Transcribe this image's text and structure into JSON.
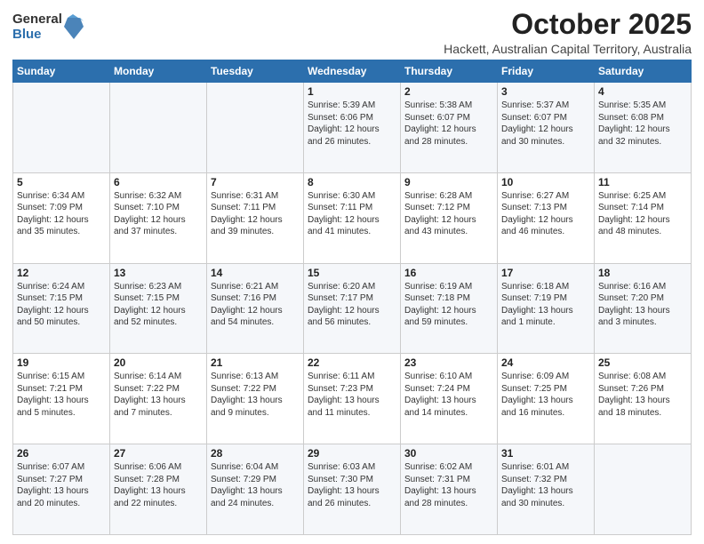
{
  "logo": {
    "general": "General",
    "blue": "Blue"
  },
  "header": {
    "month": "October 2025",
    "location": "Hackett, Australian Capital Territory, Australia"
  },
  "weekdays": [
    "Sunday",
    "Monday",
    "Tuesday",
    "Wednesday",
    "Thursday",
    "Friday",
    "Saturday"
  ],
  "weeks": [
    [
      {
        "day": "",
        "info": ""
      },
      {
        "day": "",
        "info": ""
      },
      {
        "day": "",
        "info": ""
      },
      {
        "day": "1",
        "info": "Sunrise: 5:39 AM\nSunset: 6:06 PM\nDaylight: 12 hours\nand 26 minutes."
      },
      {
        "day": "2",
        "info": "Sunrise: 5:38 AM\nSunset: 6:07 PM\nDaylight: 12 hours\nand 28 minutes."
      },
      {
        "day": "3",
        "info": "Sunrise: 5:37 AM\nSunset: 6:07 PM\nDaylight: 12 hours\nand 30 minutes."
      },
      {
        "day": "4",
        "info": "Sunrise: 5:35 AM\nSunset: 6:08 PM\nDaylight: 12 hours\nand 32 minutes."
      }
    ],
    [
      {
        "day": "5",
        "info": "Sunrise: 6:34 AM\nSunset: 7:09 PM\nDaylight: 12 hours\nand 35 minutes."
      },
      {
        "day": "6",
        "info": "Sunrise: 6:32 AM\nSunset: 7:10 PM\nDaylight: 12 hours\nand 37 minutes."
      },
      {
        "day": "7",
        "info": "Sunrise: 6:31 AM\nSunset: 7:11 PM\nDaylight: 12 hours\nand 39 minutes."
      },
      {
        "day": "8",
        "info": "Sunrise: 6:30 AM\nSunset: 7:11 PM\nDaylight: 12 hours\nand 41 minutes."
      },
      {
        "day": "9",
        "info": "Sunrise: 6:28 AM\nSunset: 7:12 PM\nDaylight: 12 hours\nand 43 minutes."
      },
      {
        "day": "10",
        "info": "Sunrise: 6:27 AM\nSunset: 7:13 PM\nDaylight: 12 hours\nand 46 minutes."
      },
      {
        "day": "11",
        "info": "Sunrise: 6:25 AM\nSunset: 7:14 PM\nDaylight: 12 hours\nand 48 minutes."
      }
    ],
    [
      {
        "day": "12",
        "info": "Sunrise: 6:24 AM\nSunset: 7:15 PM\nDaylight: 12 hours\nand 50 minutes."
      },
      {
        "day": "13",
        "info": "Sunrise: 6:23 AM\nSunset: 7:15 PM\nDaylight: 12 hours\nand 52 minutes."
      },
      {
        "day": "14",
        "info": "Sunrise: 6:21 AM\nSunset: 7:16 PM\nDaylight: 12 hours\nand 54 minutes."
      },
      {
        "day": "15",
        "info": "Sunrise: 6:20 AM\nSunset: 7:17 PM\nDaylight: 12 hours\nand 56 minutes."
      },
      {
        "day": "16",
        "info": "Sunrise: 6:19 AM\nSunset: 7:18 PM\nDaylight: 12 hours\nand 59 minutes."
      },
      {
        "day": "17",
        "info": "Sunrise: 6:18 AM\nSunset: 7:19 PM\nDaylight: 13 hours\nand 1 minute."
      },
      {
        "day": "18",
        "info": "Sunrise: 6:16 AM\nSunset: 7:20 PM\nDaylight: 13 hours\nand 3 minutes."
      }
    ],
    [
      {
        "day": "19",
        "info": "Sunrise: 6:15 AM\nSunset: 7:21 PM\nDaylight: 13 hours\nand 5 minutes."
      },
      {
        "day": "20",
        "info": "Sunrise: 6:14 AM\nSunset: 7:22 PM\nDaylight: 13 hours\nand 7 minutes."
      },
      {
        "day": "21",
        "info": "Sunrise: 6:13 AM\nSunset: 7:22 PM\nDaylight: 13 hours\nand 9 minutes."
      },
      {
        "day": "22",
        "info": "Sunrise: 6:11 AM\nSunset: 7:23 PM\nDaylight: 13 hours\nand 11 minutes."
      },
      {
        "day": "23",
        "info": "Sunrise: 6:10 AM\nSunset: 7:24 PM\nDaylight: 13 hours\nand 14 minutes."
      },
      {
        "day": "24",
        "info": "Sunrise: 6:09 AM\nSunset: 7:25 PM\nDaylight: 13 hours\nand 16 minutes."
      },
      {
        "day": "25",
        "info": "Sunrise: 6:08 AM\nSunset: 7:26 PM\nDaylight: 13 hours\nand 18 minutes."
      }
    ],
    [
      {
        "day": "26",
        "info": "Sunrise: 6:07 AM\nSunset: 7:27 PM\nDaylight: 13 hours\nand 20 minutes."
      },
      {
        "day": "27",
        "info": "Sunrise: 6:06 AM\nSunset: 7:28 PM\nDaylight: 13 hours\nand 22 minutes."
      },
      {
        "day": "28",
        "info": "Sunrise: 6:04 AM\nSunset: 7:29 PM\nDaylight: 13 hours\nand 24 minutes."
      },
      {
        "day": "29",
        "info": "Sunrise: 6:03 AM\nSunset: 7:30 PM\nDaylight: 13 hours\nand 26 minutes."
      },
      {
        "day": "30",
        "info": "Sunrise: 6:02 AM\nSunset: 7:31 PM\nDaylight: 13 hours\nand 28 minutes."
      },
      {
        "day": "31",
        "info": "Sunrise: 6:01 AM\nSunset: 7:32 PM\nDaylight: 13 hours\nand 30 minutes."
      },
      {
        "day": "",
        "info": ""
      }
    ]
  ]
}
